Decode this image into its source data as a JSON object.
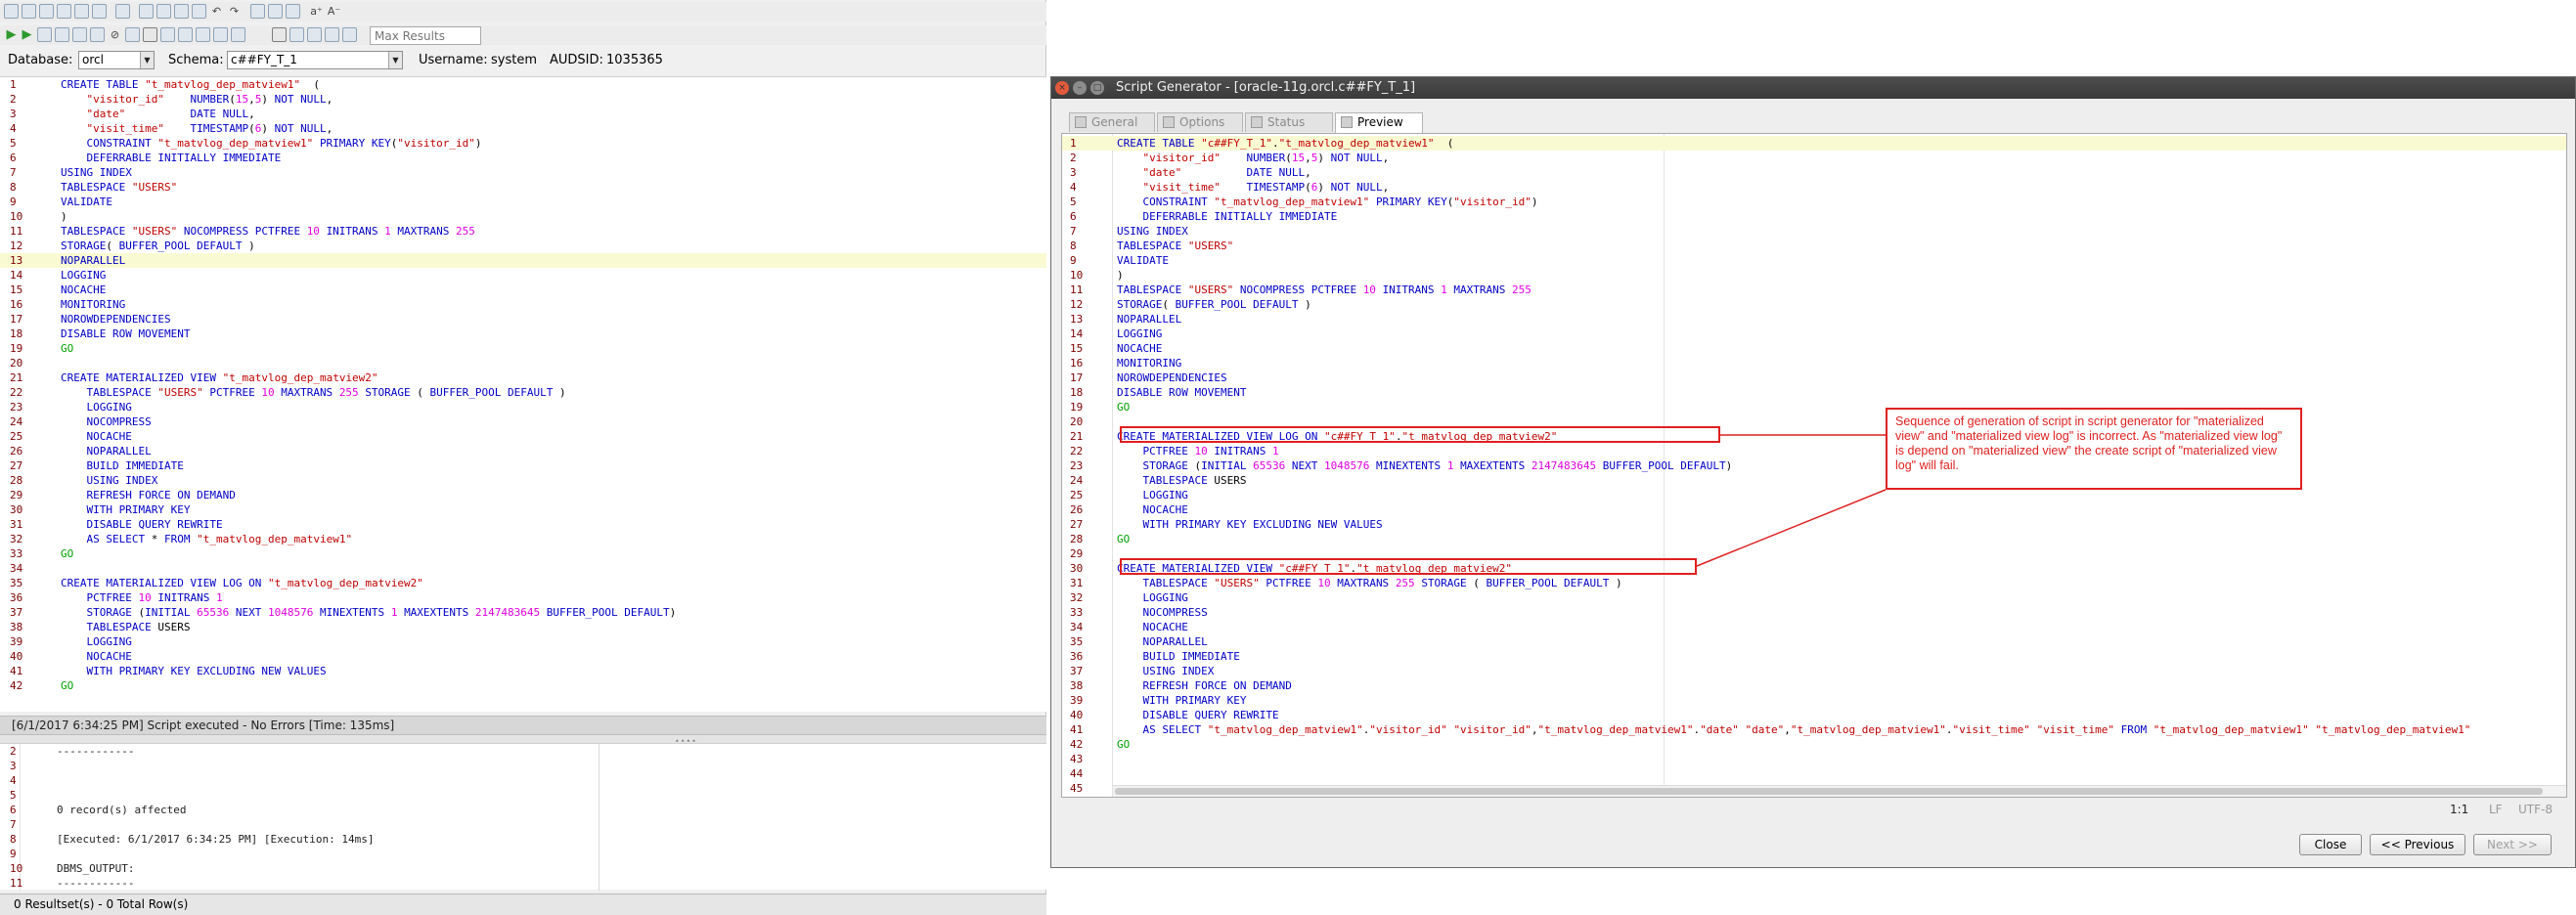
{
  "toolbar": {
    "max_results_placeholder": "Max Results",
    "sort_az": "a⁺",
    "sort_za": "A⁻"
  },
  "connection": {
    "database_label": "Database:",
    "database_value": "orcl",
    "schema_label": "Schema:",
    "schema_value": "c##FY_T_1",
    "username_label": "Username:",
    "username_value": "system",
    "audsid_label": "AUDSID:",
    "audsid_value": "1035365"
  },
  "editor": {
    "lines": [
      {
        "n": "1",
        "t": "CREATE TABLE \"t_matvlog_dep_matview1\"  ("
      },
      {
        "n": "2",
        "t": "    \"visitor_id\"    NUMBER(15,5) NOT NULL,"
      },
      {
        "n": "3",
        "t": "    \"date\"          DATE NULL,"
      },
      {
        "n": "4",
        "t": "    \"visit_time\"    TIMESTAMP(6) NOT NULL,"
      },
      {
        "n": "5",
        "t": "    CONSTRAINT \"t_matvlog_dep_matview1\" PRIMARY KEY(\"visitor_id\")"
      },
      {
        "n": "6",
        "t": "    DEFERRABLE INITIALLY IMMEDIATE"
      },
      {
        "n": "7",
        "t": "USING INDEX"
      },
      {
        "n": "8",
        "t": "TABLESPACE \"USERS\""
      },
      {
        "n": "9",
        "t": "VALIDATE"
      },
      {
        "n": "10",
        "t": ")"
      },
      {
        "n": "11",
        "t": "TABLESPACE \"USERS\" NOCOMPRESS PCTFREE 10 INITRANS 1 MAXTRANS 255"
      },
      {
        "n": "12",
        "t": "STORAGE( BUFFER_POOL DEFAULT )"
      },
      {
        "n": "13",
        "t": "NOPARALLEL"
      },
      {
        "n": "14",
        "t": "LOGGING"
      },
      {
        "n": "15",
        "t": "NOCACHE"
      },
      {
        "n": "16",
        "t": "MONITORING"
      },
      {
        "n": "17",
        "t": "NOROWDEPENDENCIES"
      },
      {
        "n": "18",
        "t": "DISABLE ROW MOVEMENT"
      },
      {
        "n": "19",
        "t": "GO"
      },
      {
        "n": "20",
        "t": ""
      },
      {
        "n": "21",
        "t": "CREATE MATERIALIZED VIEW \"t_matvlog_dep_matview2\""
      },
      {
        "n": "22",
        "t": "    TABLESPACE \"USERS\" PCTFREE 10 MAXTRANS 255 STORAGE ( BUFFER_POOL DEFAULT )"
      },
      {
        "n": "23",
        "t": "    LOGGING"
      },
      {
        "n": "24",
        "t": "    NOCOMPRESS"
      },
      {
        "n": "25",
        "t": "    NOCACHE"
      },
      {
        "n": "26",
        "t": "    NOPARALLEL"
      },
      {
        "n": "27",
        "t": "    BUILD IMMEDIATE"
      },
      {
        "n": "28",
        "t": "    USING INDEX"
      },
      {
        "n": "29",
        "t": "    REFRESH FORCE ON DEMAND"
      },
      {
        "n": "30",
        "t": "    WITH PRIMARY KEY"
      },
      {
        "n": "31",
        "t": "    DISABLE QUERY REWRITE"
      },
      {
        "n": "32",
        "t": "    AS SELECT * FROM \"t_matvlog_dep_matview1\""
      },
      {
        "n": "33",
        "t": "GO"
      },
      {
        "n": "34",
        "t": ""
      },
      {
        "n": "35",
        "t": "CREATE MATERIALIZED VIEW LOG ON \"t_matvlog_dep_matview2\""
      },
      {
        "n": "36",
        "t": "    PCTFREE 10 INITRANS 1"
      },
      {
        "n": "37",
        "t": "    STORAGE (INITIAL 65536 NEXT 1048576 MINEXTENTS 1 MAXEXTENTS 2147483645 BUFFER_POOL DEFAULT)"
      },
      {
        "n": "38",
        "t": "    TABLESPACE USERS"
      },
      {
        "n": "39",
        "t": "    LOGGING"
      },
      {
        "n": "40",
        "t": "    NOCACHE"
      },
      {
        "n": "41",
        "t": "    WITH PRIMARY KEY EXCLUDING NEW VALUES"
      },
      {
        "n": "42",
        "t": "GO"
      }
    ]
  },
  "status_message": "[6/1/2017 6:34:25 PM] Script executed - No Errors [Time: 135ms]",
  "output": {
    "lines": [
      {
        "n": "2",
        "t": "------------"
      },
      {
        "n": "3",
        "t": ""
      },
      {
        "n": "4",
        "t": ""
      },
      {
        "n": "5",
        "t": ""
      },
      {
        "n": "6",
        "t": "0 record(s) affected"
      },
      {
        "n": "7",
        "t": ""
      },
      {
        "n": "8",
        "t": "[Executed: 6/1/2017 6:34:25 PM] [Execution: 14ms]"
      },
      {
        "n": "9",
        "t": ""
      },
      {
        "n": "10",
        "t": "DBMS_OUTPUT:"
      },
      {
        "n": "11",
        "t": "------------"
      }
    ]
  },
  "result_bar": "0 Resultset(s) - 0 Total Row(s)",
  "dialog": {
    "title": "Script Generator - [oracle-11g.orcl.c##FY_T_1]",
    "tabs": [
      {
        "label": "General",
        "active": false
      },
      {
        "label": "Options",
        "active": false
      },
      {
        "label": "Status",
        "active": false
      },
      {
        "label": "Preview",
        "active": true
      }
    ],
    "preview_lines": [
      {
        "n": "1",
        "t": "CREATE TABLE \"c##FY_T_1\".\"t_matvlog_dep_matview1\"  ("
      },
      {
        "n": "2",
        "t": "    \"visitor_id\"    NUMBER(15,5) NOT NULL,"
      },
      {
        "n": "3",
        "t": "    \"date\"          DATE NULL,"
      },
      {
        "n": "4",
        "t": "    \"visit_time\"    TIMESTAMP(6) NOT NULL,"
      },
      {
        "n": "5",
        "t": "    CONSTRAINT \"t_matvlog_dep_matview1\" PRIMARY KEY(\"visitor_id\")"
      },
      {
        "n": "6",
        "t": "    DEFERRABLE INITIALLY IMMEDIATE"
      },
      {
        "n": "7",
        "t": "USING INDEX"
      },
      {
        "n": "8",
        "t": "TABLESPACE \"USERS\""
      },
      {
        "n": "9",
        "t": "VALIDATE"
      },
      {
        "n": "10",
        "t": ")"
      },
      {
        "n": "11",
        "t": "TABLESPACE \"USERS\" NOCOMPRESS PCTFREE 10 INITRANS 1 MAXTRANS 255"
      },
      {
        "n": "12",
        "t": "STORAGE( BUFFER_POOL DEFAULT )"
      },
      {
        "n": "13",
        "t": "NOPARALLEL"
      },
      {
        "n": "14",
        "t": "LOGGING"
      },
      {
        "n": "15",
        "t": "NOCACHE"
      },
      {
        "n": "16",
        "t": "MONITORING"
      },
      {
        "n": "17",
        "t": "NOROWDEPENDENCIES"
      },
      {
        "n": "18",
        "t": "DISABLE ROW MOVEMENT"
      },
      {
        "n": "19",
        "t": "GO"
      },
      {
        "n": "20",
        "t": ""
      },
      {
        "n": "21",
        "t": "CREATE MATERIALIZED VIEW LOG ON \"c##FY_T_1\".\"t_matvlog_dep_matview2\""
      },
      {
        "n": "22",
        "t": "    PCTFREE 10 INITRANS 1"
      },
      {
        "n": "23",
        "t": "    STORAGE (INITIAL 65536 NEXT 1048576 MINEXTENTS 1 MAXEXTENTS 2147483645 BUFFER_POOL DEFAULT)"
      },
      {
        "n": "24",
        "t": "    TABLESPACE USERS"
      },
      {
        "n": "25",
        "t": "    LOGGING"
      },
      {
        "n": "26",
        "t": "    NOCACHE"
      },
      {
        "n": "27",
        "t": "    WITH PRIMARY KEY EXCLUDING NEW VALUES"
      },
      {
        "n": "28",
        "t": "GO"
      },
      {
        "n": "29",
        "t": ""
      },
      {
        "n": "30",
        "t": "CREATE MATERIALIZED VIEW \"c##FY_T_1\".\"t_matvlog_dep_matview2\""
      },
      {
        "n": "31",
        "t": "    TABLESPACE \"USERS\" PCTFREE 10 MAXTRANS 255 STORAGE ( BUFFER_POOL DEFAULT )"
      },
      {
        "n": "32",
        "t": "    LOGGING"
      },
      {
        "n": "33",
        "t": "    NOCOMPRESS"
      },
      {
        "n": "34",
        "t": "    NOCACHE"
      },
      {
        "n": "35",
        "t": "    NOPARALLEL"
      },
      {
        "n": "36",
        "t": "    BUILD IMMEDIATE"
      },
      {
        "n": "37",
        "t": "    USING INDEX"
      },
      {
        "n": "38",
        "t": "    REFRESH FORCE ON DEMAND"
      },
      {
        "n": "39",
        "t": "    WITH PRIMARY KEY"
      },
      {
        "n": "40",
        "t": "    DISABLE QUERY REWRITE"
      },
      {
        "n": "41",
        "t": "    AS SELECT \"t_matvlog_dep_matview1\".\"visitor_id\" \"visitor_id\",\"t_matvlog_dep_matview1\".\"date\" \"date\",\"t_matvlog_dep_matview1\".\"visit_time\" \"visit_time\" FROM \"t_matvlog_dep_matview1\" \"t_matvlog_dep_matview1\""
      },
      {
        "n": "42",
        "t": "GO"
      },
      {
        "n": "43",
        "t": ""
      },
      {
        "n": "44",
        "t": ""
      },
      {
        "n": "45",
        "t": ""
      }
    ],
    "cursor_pos": "1:1",
    "line_ending": "LF",
    "encoding": "UTF-8",
    "buttons": {
      "close": "Close",
      "prev": "<< Previous",
      "next": "Next >>"
    }
  },
  "annotation": {
    "callout": "Sequence of generation of script in script generator for \"materialized view\" and \"materialized view log\" is incorrect. As \"materialized view log\" is depend on \"materialized view\" the create script of \"materialized view log\" will fail."
  },
  "colors": {
    "keyword": "#0000c8",
    "string": "#c00000",
    "number": "#e000e0",
    "go": "#00a000",
    "annotation": "#e02020",
    "current_line": "#fafad2"
  }
}
